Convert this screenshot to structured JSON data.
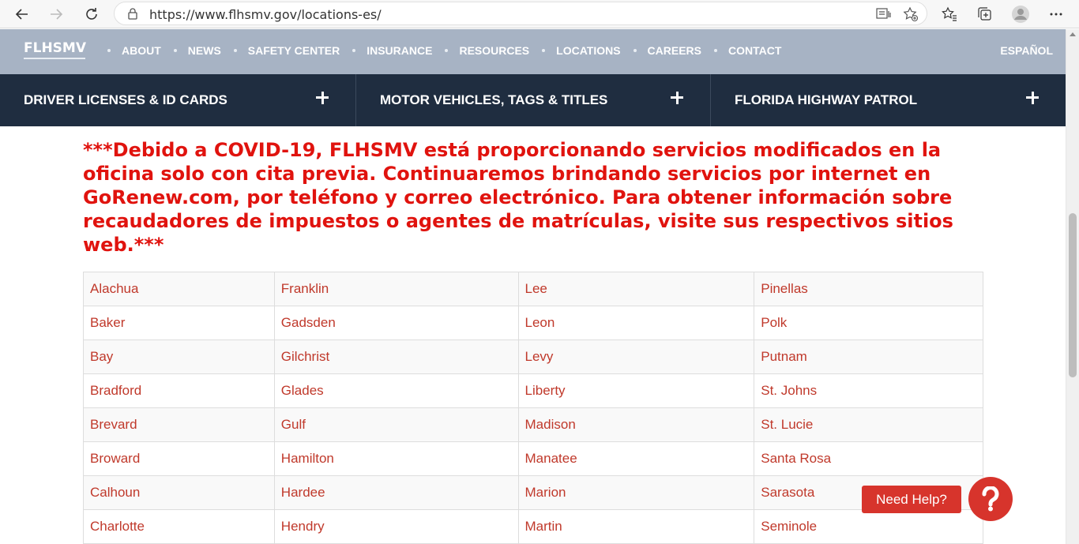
{
  "browser": {
    "url": "https://www.flhsmv.gov/locations-es/"
  },
  "site": {
    "logo_text": "FLHSMV",
    "menu": [
      "ABOUT",
      "NEWS",
      "SAFETY CENTER",
      "INSURANCE",
      "RESOURCES",
      "LOCATIONS",
      "CAREERS",
      "CONTACT"
    ],
    "language_link": "ESPAÑOL",
    "sub_nav": [
      "DRIVER LICENSES & ID CARDS",
      "MOTOR VEHICLES, TAGS & TITLES",
      "FLORIDA HIGHWAY PATROL"
    ],
    "colors": {
      "top_nav": "#a7b3c4",
      "sub_nav": "#1f2d40",
      "alert": "#e0130e",
      "link": "#c0392b"
    }
  },
  "notice": "***Debido a COVID-19, FLHSMV está proporcionando servicios modificados en la oficina solo con cita previa. Continuaremos brindando servicios por internet en GoRenew.com, por teléfono y correo electrónico. Para obtener información sobre recaudadores de impuestos o agentes de matrículas, visite sus respectivos sitios web.***",
  "counties": [
    [
      "Alachua",
      "Franklin",
      "Lee",
      "Pinellas"
    ],
    [
      "Baker",
      "Gadsden",
      "Leon",
      "Polk"
    ],
    [
      "Bay",
      "Gilchrist",
      "Levy",
      "Putnam"
    ],
    [
      "Bradford",
      "Glades",
      "Liberty",
      "St. Johns"
    ],
    [
      "Brevard",
      "Gulf",
      "Madison",
      "St. Lucie"
    ],
    [
      "Broward",
      "Hamilton",
      "Manatee",
      "Santa Rosa"
    ],
    [
      "Calhoun",
      "Hardee",
      "Marion",
      "Sarasota"
    ],
    [
      "Charlotte",
      "Hendry",
      "Martin",
      "Seminole"
    ]
  ],
  "help": {
    "label": "Need Help?",
    "icon": "question-icon"
  }
}
